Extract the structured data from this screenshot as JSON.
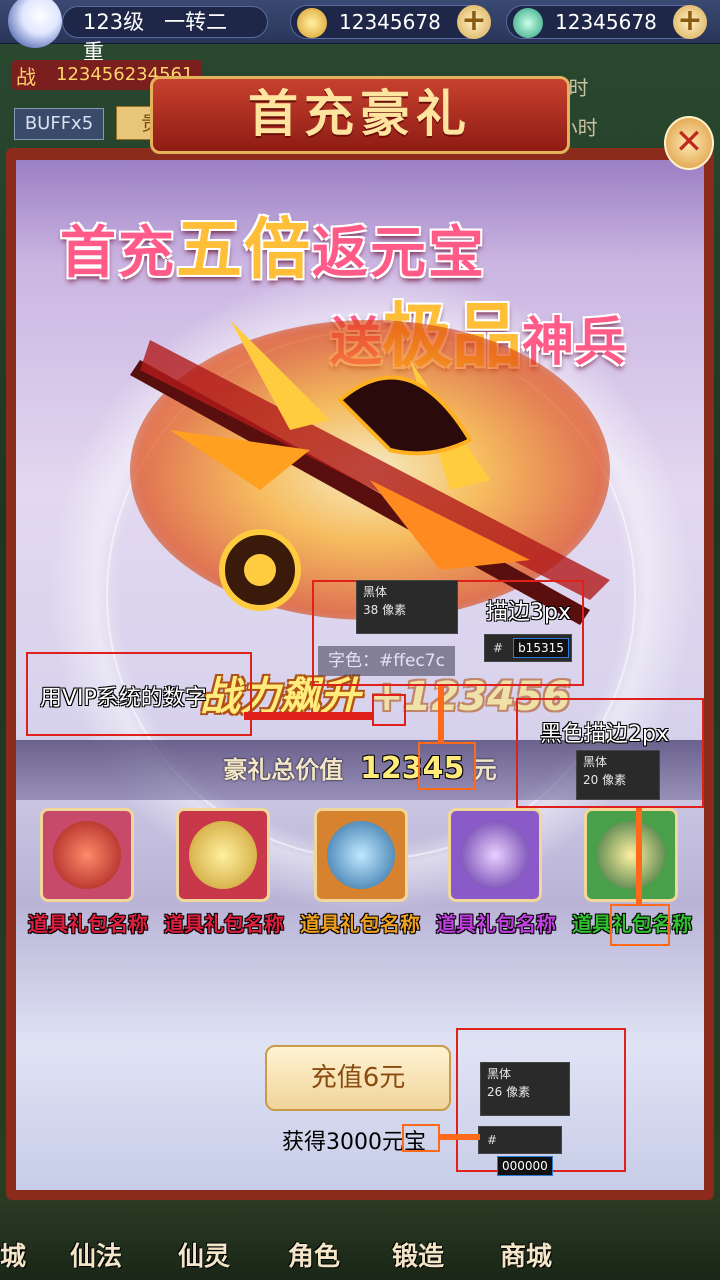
{
  "topbar": {
    "level": "123级",
    "rank": "一转二重",
    "gold": "12345678",
    "jade": "12345678",
    "plus": "+"
  },
  "hud": {
    "power_icon": "战",
    "power": "12345623456​1",
    "buff": "BUFFx5",
    "tab": "贵族",
    "rate1": "12345678/小时",
    "rate2": "5678/小时"
  },
  "panel": {
    "title": "首充豪礼",
    "close": "✕",
    "headline1_a": "首充",
    "headline1_b": "五倍",
    "headline1_c": "返元宝",
    "headline2_a": "送",
    "headline2_b": "极品",
    "headline2_c": "神兵",
    "power_label": "战力飙升",
    "power_num": "+123456",
    "value_prefix": "豪礼总价值",
    "value_num": "12345",
    "value_suffix": "元"
  },
  "items": [
    {
      "label": "道具礼包名称",
      "color": "#e02040",
      "bg": "#c84a6a"
    },
    {
      "label": "道具礼包名称",
      "color": "#e02040",
      "bg": "#c8384a"
    },
    {
      "label": "道具礼包名称",
      "color": "#f0a020",
      "bg": "#d6822e"
    },
    {
      "label": "道具礼包名称",
      "color": "#c040e0",
      "bg": "#8a5ac8"
    },
    {
      "label": "道具礼包名称",
      "color": "#30c030",
      "bg": "#4aa04a"
    }
  ],
  "recharge": {
    "button": "充值6元",
    "get": "获得3000元宝"
  },
  "nav": [
    "城",
    "仙法",
    "仙灵",
    "角色",
    "锻造",
    "商城"
  ],
  "annotations": {
    "vip_note": "用VIP系统的数字",
    "stroke3": "描边3px",
    "font_color": "字色：#ffec7c",
    "font1": "黑体",
    "size1": "38 像素",
    "hex1": "b15315",
    "stroke2": "黑色描边2px",
    "font2": "黑体",
    "size2": "20 像素",
    "font3": "黑体",
    "size3": "26 像素",
    "hex3": "000000",
    "hash": "#"
  }
}
